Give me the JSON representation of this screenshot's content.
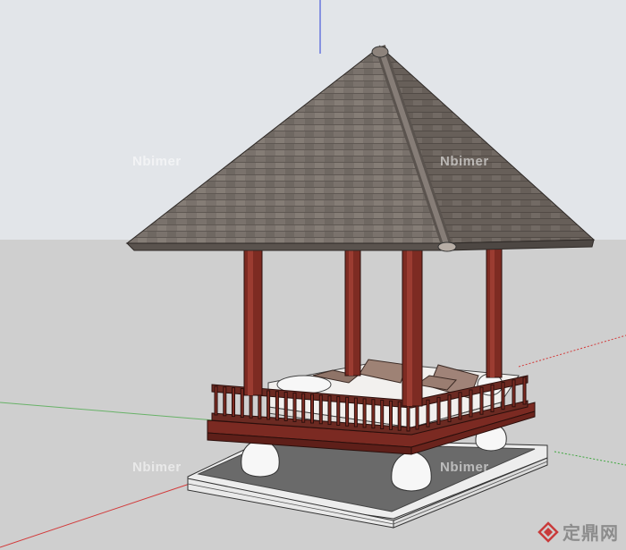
{
  "scene": {
    "subject": "pavilion-model",
    "axes": {
      "blue": "#2b3fd6",
      "red": "#d23a3a",
      "green": "#3da63d"
    },
    "colors": {
      "sky": "#e2e5e9",
      "ground": "#cfcfcf",
      "roof": "#7a726c",
      "roof_dark": "#5e5752",
      "pillar": "#7d2b22",
      "rail": "#6b2a22",
      "cushion": "#a08378",
      "mattress": "#f2f0ee",
      "base": "#f5f5f5"
    }
  },
  "watermarks": [
    "Nbimer",
    "Nbimer",
    "Nbimer",
    "Nbimer"
  ],
  "brand": {
    "text": "定鼎网",
    "icon": "diamond-logo-icon"
  }
}
